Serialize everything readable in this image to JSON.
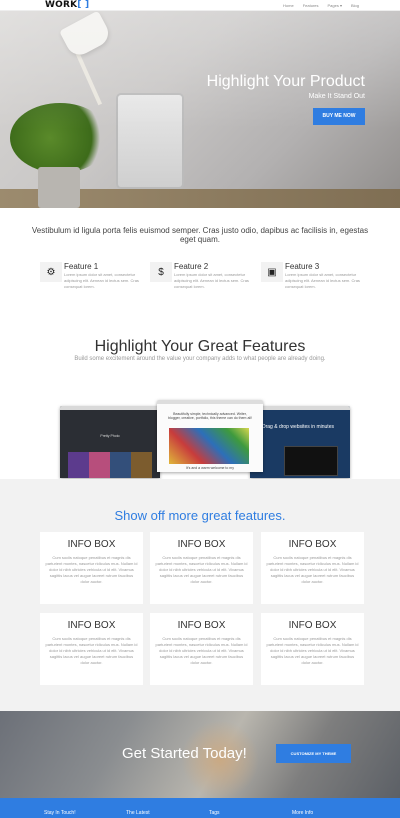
{
  "nav": {
    "logo_main": "WORK",
    "logo_accent": "[ ]",
    "links": [
      "Home",
      "Features",
      "Pages ▾",
      "Blog"
    ]
  },
  "hero": {
    "title": "Highlight Your Product",
    "subtitle": "Make It Stand Out",
    "button": "BUY ME NOW"
  },
  "intro": {
    "text": "Vestibulum id ligula porta felis euismod semper. Cras justo odio, dapibus ac facilisis in, egestas eget quam."
  },
  "features": [
    {
      "icon": "gear-icon",
      "glyph": "⚙",
      "title": "Feature 1",
      "desc": "Lorem ipsum dolor sit amet, consectetur adipiscing elit. Aenean id lectus sem. Cras consequat lorem."
    },
    {
      "icon": "dollar-icon",
      "glyph": "$",
      "title": "Feature 2",
      "desc": "Lorem ipsum dolor sit amet, consectetur adipiscing elit. Aenean id lectus sem. Cras consequat lorem."
    },
    {
      "icon": "briefcase-icon",
      "glyph": "▣",
      "title": "Feature 3",
      "desc": "Lorem ipsum dolor sit amet, consectetur adipiscing elit. Aenean id lectus sem. Cras consequat lorem."
    }
  ],
  "showcase": {
    "title": "Highlight Your Great Features",
    "subtitle": "Build some excitement around the value your company adds to what people are already doing.",
    "screen1_text": "Pretty Photo",
    "screen2_text": "Beautifully simple, technically advanced. Writer, blogger, creative, portfolio, this theme can do them all!",
    "screen2_bottom": "It's and a warm welcome to my",
    "screen3_text": "Drag & drop websites in minutes"
  },
  "info": {
    "title": "Show off more great features.",
    "boxes": [
      {
        "heading": "INFO BOX",
        "text": "Cum sociis natoque penatibus et magnis dis parturient montes, nascetur ridiculus mus. Nullam id dolor id nibh ultricies vehicula ut id elit. Vivamus sagittis lacus vel augue laoreet rutrum faucibus dolor auctor."
      },
      {
        "heading": "INFO BOX",
        "text": "Cum sociis natoque penatibus et magnis dis parturient montes, nascetur ridiculus mus. Nullam id dolor id nibh ultricies vehicula ut id elit. Vivamus sagittis lacus vel augue laoreet rutrum faucibus dolor auctor."
      },
      {
        "heading": "INFO BOX",
        "text": "Cum sociis natoque penatibus et magnis dis parturient montes, nascetur ridiculus mus. Nullam id dolor id nibh ultricies vehicula ut id elit. Vivamus sagittis lacus vel augue laoreet rutrum faucibus dolor auctor."
      },
      {
        "heading": "INFO BOX",
        "text": "Cum sociis natoque penatibus et magnis dis parturient montes, nascetur ridiculus mus. Nullam id dolor id nibh ultricies vehicula ut id elit. Vivamus sagittis lacus vel augue laoreet rutrum faucibus dolor auctor."
      },
      {
        "heading": "INFO BOX",
        "text": "Cum sociis natoque penatibus et magnis dis parturient montes, nascetur ridiculus mus. Nullam id dolor id nibh ultricies vehicula ut id elit. Vivamus sagittis lacus vel augue laoreet rutrum faucibus dolor auctor."
      },
      {
        "heading": "INFO BOX",
        "text": "Cum sociis natoque penatibus et magnis dis parturient montes, nascetur ridiculus mus. Nullam id dolor id nibh ultricies vehicula ut id elit. Vivamus sagittis lacus vel augue laoreet rutrum faucibus dolor auctor."
      }
    ]
  },
  "cta": {
    "title": "Get Started Today!",
    "button": "CUSTOMIZE MY THEME"
  },
  "footer": {
    "columns": [
      "Stay In Touch!",
      "The Latest",
      "Tags",
      "More Info"
    ]
  },
  "colors": {
    "accent": "#2f7de1"
  }
}
